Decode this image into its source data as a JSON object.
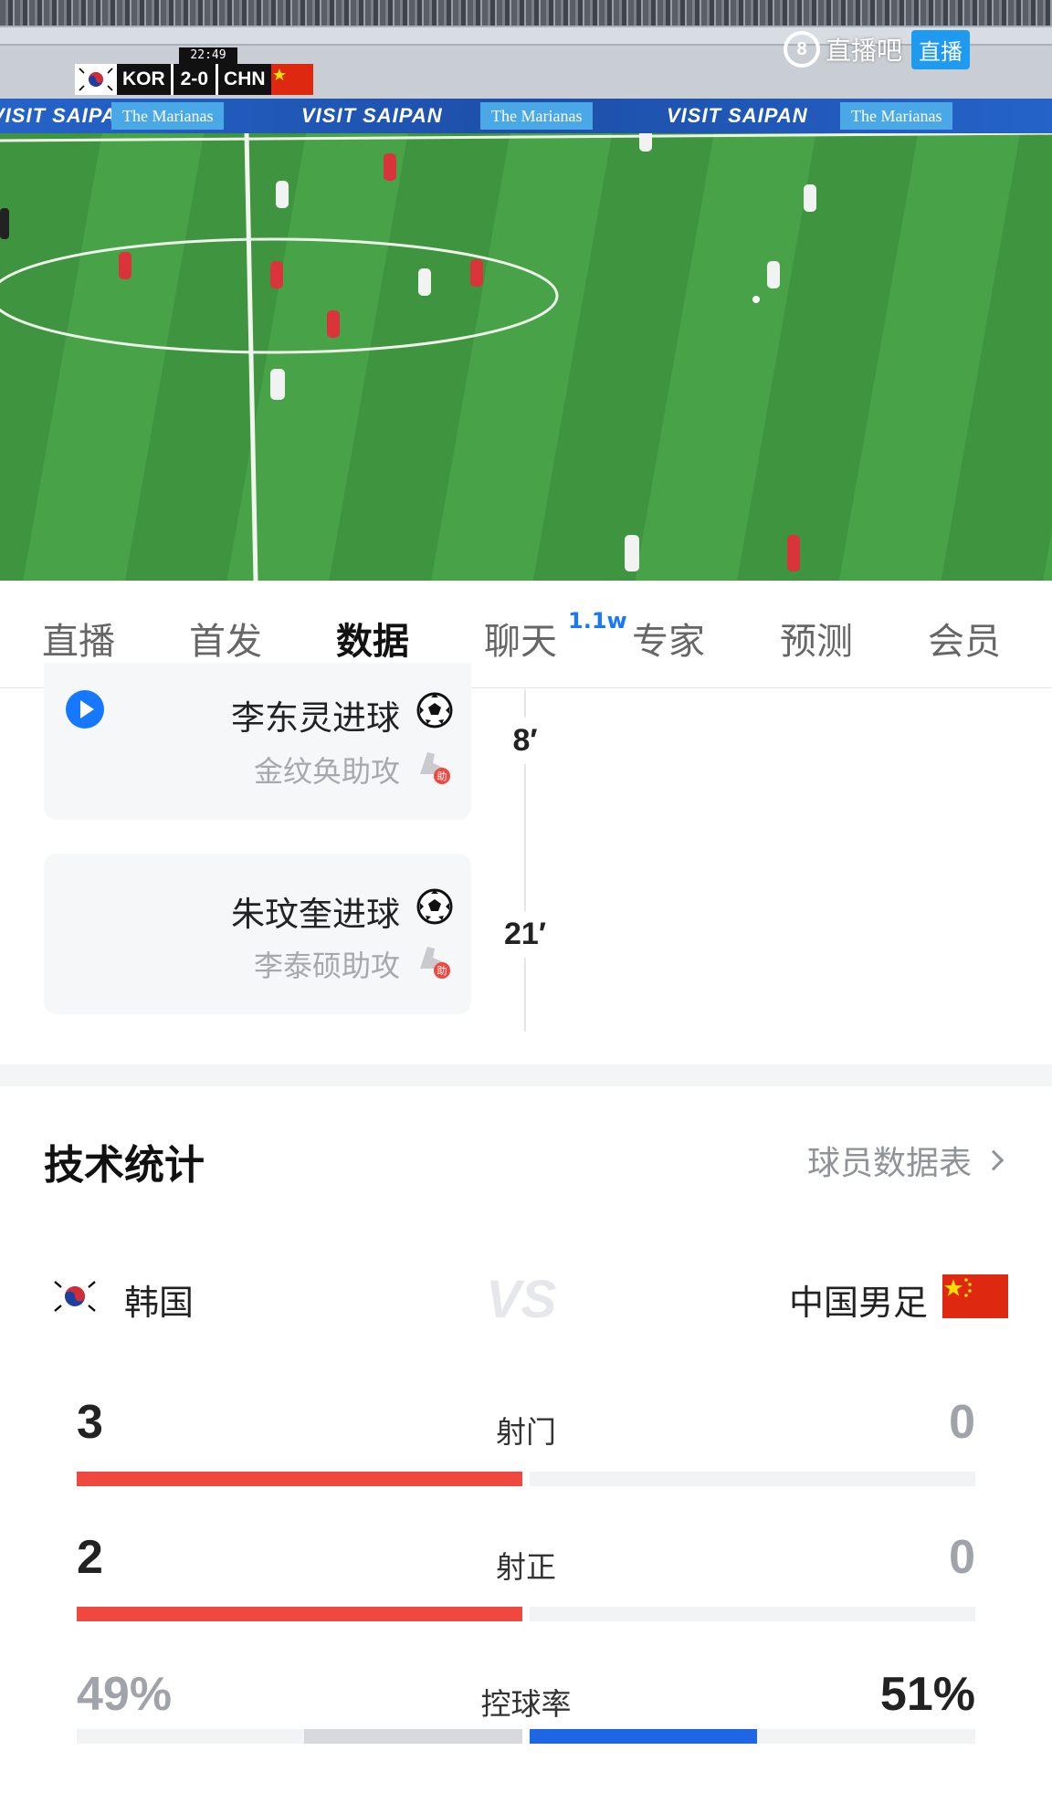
{
  "video": {
    "scorebug": {
      "clock": "22:49",
      "home_code": "KOR",
      "score": "2-0",
      "away_code": "CHN"
    },
    "ads": {
      "marianas": "The Marianas",
      "saipan": "VISIT SAIPAN"
    },
    "watermark": {
      "logo": "8",
      "brand": "直播吧",
      "live_badge": "直播"
    }
  },
  "tabs": [
    {
      "label": "直播"
    },
    {
      "label": "首发"
    },
    {
      "label": "数据",
      "active": true
    },
    {
      "label": "聊天",
      "badge": "1.1w"
    },
    {
      "label": "专家"
    },
    {
      "label": "预测"
    },
    {
      "label": "会员"
    }
  ],
  "timeline": {
    "events": [
      {
        "scorer": "李东灵进球",
        "assist": "金纹奂助攻",
        "minute": "8′",
        "has_video": true
      },
      {
        "scorer": "朱玟奎进球",
        "assist": "李泰硕助攻",
        "minute": "21′",
        "has_video": false
      }
    ],
    "assist_badge": "助"
  },
  "stats": {
    "title": "技术统计",
    "player_table_link": "球员数据表",
    "home_team": "韩国",
    "away_team": "中国男足",
    "vs": "VS",
    "rows": [
      {
        "label": "射门",
        "home": "3",
        "away": "0",
        "home_share": 1.0,
        "away_share": 0.0
      },
      {
        "label": "射正",
        "home": "2",
        "away": "0",
        "home_share": 1.0,
        "away_share": 0.0
      },
      {
        "label": "控球率",
        "home": "49%",
        "away": "51%",
        "home_share": 0.49,
        "away_share": 0.51
      }
    ],
    "colors": {
      "home_bar": "#f0473e",
      "possession_home_bar": "#d7d9de",
      "possession_away_bar": "#1f66e5",
      "accent": "#1677ff"
    }
  }
}
